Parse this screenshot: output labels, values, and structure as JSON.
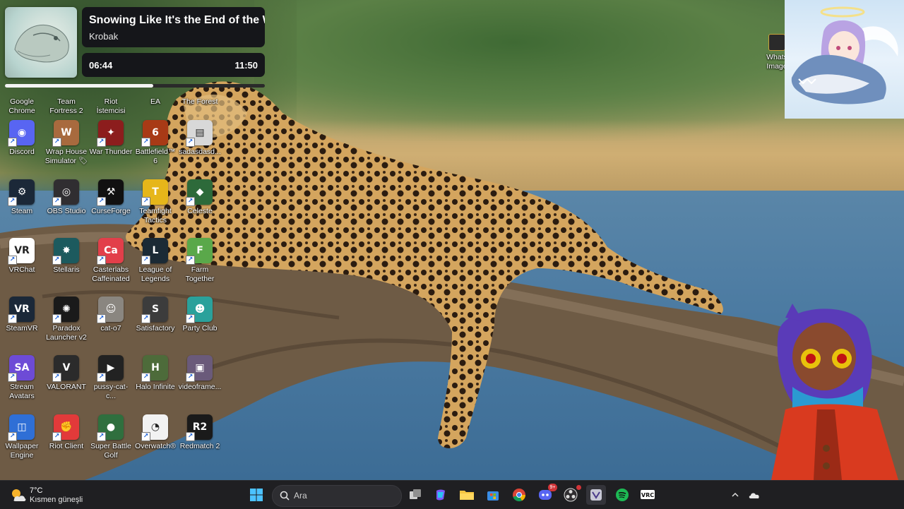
{
  "music_player": {
    "title": "Snowing Like It's the End of the World",
    "artist": "Krobak",
    "elapsed": "06:44",
    "duration": "11:50",
    "progress": 0.57
  },
  "desktop_icons": [
    {
      "label": "Google Chrome",
      "icon": "chrome-icon",
      "color": "#ffffff",
      "glyph": "◍"
    },
    {
      "label": "Team Fortress 2",
      "icon": "team-fortress-icon",
      "color": "#b0533a",
      "glyph": "TF"
    },
    {
      "label": "Riot İstemcisi",
      "icon": "riot-client-icon",
      "color": "#d13639",
      "glyph": "R"
    },
    {
      "label": "EA",
      "icon": "ea-icon",
      "color": "#f05a28",
      "glyph": "EA"
    },
    {
      "label": "The Forest",
      "icon": "the-forest-icon",
      "color": "#24331f",
      "glyph": "F"
    },
    {
      "label": "Discord",
      "icon": "discord-icon",
      "color": "#5865f2",
      "glyph": "◉"
    },
    {
      "label": "Wrap House Simulator 🏷",
      "icon": "wrap-house-icon",
      "color": "#a86a3e",
      "glyph": "W"
    },
    {
      "label": "War Thunder",
      "icon": "war-thunder-icon",
      "color": "#8c1d1d",
      "glyph": "✦"
    },
    {
      "label": "Battlefield™ 6",
      "icon": "battlefield-icon",
      "color": "#a83a16",
      "glyph": "6"
    },
    {
      "label": "sadasdasd...",
      "icon": "file-icon",
      "color": "#d8d8d8",
      "glyph": "▤"
    },
    {
      "label": "Steam",
      "icon": "steam-icon",
      "color": "#1b2838",
      "glyph": "⚙"
    },
    {
      "label": "OBS Studio",
      "icon": "obs-icon",
      "color": "#302e31",
      "glyph": "◎"
    },
    {
      "label": "CurseForge",
      "icon": "curseforge-icon",
      "color": "#111111",
      "glyph": "⚒"
    },
    {
      "label": "Teamfight Tactics",
      "icon": "teamfight-tactics-icon",
      "color": "#e6b61a",
      "glyph": "T"
    },
    {
      "label": "Celeste",
      "icon": "celeste-icon",
      "color": "#2d6a3a",
      "glyph": "◆"
    },
    {
      "label": "VRChat",
      "icon": "vrchat-icon",
      "color": "#ffffff",
      "glyph": "VR"
    },
    {
      "label": "Stellaris",
      "icon": "stellaris-icon",
      "color": "#1c5a5e",
      "glyph": "✸"
    },
    {
      "label": "Casterlabs Caffeinated",
      "icon": "casterlabs-icon",
      "color": "#e23f4a",
      "glyph": "Ca"
    },
    {
      "label": "League of Legends",
      "icon": "league-of-legends-icon",
      "color": "#1b2a35",
      "glyph": "L"
    },
    {
      "label": "Farm Together",
      "icon": "farm-together-icon",
      "color": "#5aa84a",
      "glyph": "F"
    },
    {
      "label": "SteamVR",
      "icon": "steamvr-icon",
      "color": "#1b2838",
      "glyph": "VR"
    },
    {
      "label": "Paradox Launcher v2",
      "icon": "paradox-icon",
      "color": "#1a1a1a",
      "glyph": "✺"
    },
    {
      "label": "cat-o7",
      "icon": "cat-image-icon",
      "color": "#8a8680",
      "glyph": "☺"
    },
    {
      "label": "Satisfactory",
      "icon": "satisfactory-icon",
      "color": "#3c3c3c",
      "glyph": "S"
    },
    {
      "label": "Party Club",
      "icon": "party-club-icon",
      "color": "#2aa19b",
      "glyph": "☻"
    },
    {
      "label": "Stream Avatars",
      "icon": "stream-avatars-icon",
      "color": "#6d4bd6",
      "glyph": "SA"
    },
    {
      "label": "VALORANT",
      "icon": "valorant-icon",
      "color": "#2b2b2b",
      "glyph": "V"
    },
    {
      "label": "pussy-cat-c...",
      "icon": "video-file-icon",
      "color": "#222222",
      "glyph": "▶"
    },
    {
      "label": "Halo Infinite",
      "icon": "halo-infinite-icon",
      "color": "#4d6b3a",
      "glyph": "H"
    },
    {
      "label": "videoframe...",
      "icon": "image-file-icon",
      "color": "#6a5a7a",
      "glyph": "▣"
    },
    {
      "label": "Wallpaper Engine",
      "icon": "wallpaper-engine-icon",
      "color": "#2f6fd6",
      "glyph": "◫"
    },
    {
      "label": "Riot Client",
      "icon": "riot-client-icon",
      "color": "#e23a3a",
      "glyph": "✊"
    },
    {
      "label": "Super Battle Golf",
      "icon": "super-battle-golf-icon",
      "color": "#2f6f3e",
      "glyph": "●"
    },
    {
      "label": "Overwatch®",
      "icon": "overwatch-icon",
      "color": "#f2f2f2",
      "glyph": "◔"
    },
    {
      "label": "Redmatch 2",
      "icon": "redmatch-icon",
      "color": "#1a1a1a",
      "glyph": "R2"
    }
  ],
  "right_icon": {
    "label": "Whats Image",
    "icon": "whatsapp-image-icon"
  },
  "taskbar": {
    "weather": {
      "temp": "7°C",
      "desc": "Kısmen güneşli"
    },
    "search_placeholder": "Ara",
    "discord_badge": "9+",
    "apps": [
      {
        "name": "start-button",
        "icon": "windows-icon"
      },
      {
        "name": "task-view-button",
        "icon": "task-view-icon"
      },
      {
        "name": "copilot-button",
        "icon": "copilot-icon"
      },
      {
        "name": "file-explorer-button",
        "icon": "folder-icon"
      },
      {
        "name": "store-button",
        "icon": "store-icon"
      },
      {
        "name": "chrome-button",
        "icon": "chrome-icon"
      },
      {
        "name": "discord-button",
        "icon": "discord-icon"
      },
      {
        "name": "obs-button",
        "icon": "obs-icon"
      },
      {
        "name": "vtuber-app-button",
        "icon": "vtuber-icon"
      },
      {
        "name": "spotify-button",
        "icon": "spotify-icon"
      },
      {
        "name": "vrchat-button",
        "icon": "vrchat-icon"
      }
    ]
  }
}
